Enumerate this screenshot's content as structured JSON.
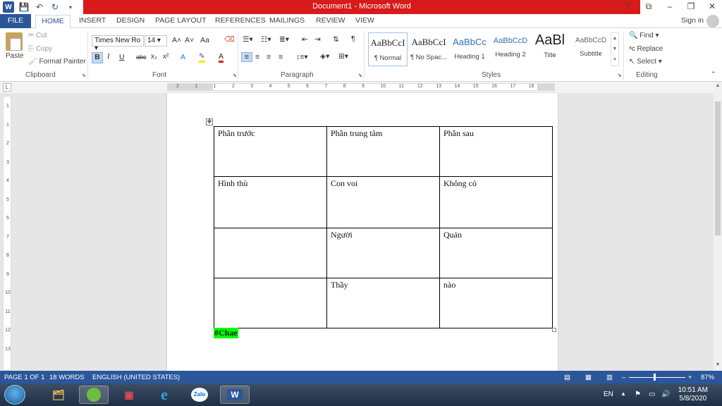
{
  "window": {
    "title": "Document1 - Microsoft Word",
    "controls": [
      "?",
      "⧉",
      "–",
      "❐",
      "✕"
    ]
  },
  "qat": {
    "word_icon": "W",
    "save_icon": "save-icon",
    "undo_icon": "undo-icon",
    "redo_icon": "redo-icon"
  },
  "tabs": [
    "FILE",
    "HOME",
    "INSERT",
    "DESIGN",
    "PAGE LAYOUT",
    "REFERENCES",
    "MAILINGS",
    "REVIEW",
    "VIEW"
  ],
  "signin": "Sign in",
  "clipboard": {
    "paste": "Paste",
    "cut": "Cut",
    "copy": "Copy",
    "format_painter": "Format Painter",
    "label": "Clipboard"
  },
  "font": {
    "name": "Times New Ro",
    "size": "14",
    "grow": "A˄",
    "shrink": "A˅",
    "case": "Aa",
    "bold": "B",
    "italic": "I",
    "underline": "U",
    "strike": "abc",
    "subscript": "x₂",
    "superscript": "x²",
    "label": "Font"
  },
  "paragraph": {
    "label": "Paragraph"
  },
  "styles": {
    "items": [
      {
        "sample": "AaBbCcI",
        "name": "¶ Normal"
      },
      {
        "sample": "AaBbCcI",
        "name": "¶ No Spac..."
      },
      {
        "sample": "AaBbCc",
        "name": "Heading 1"
      },
      {
        "sample": "AaBbCcD",
        "name": "Heading 2"
      },
      {
        "sample": "AaBl",
        "name": "Title"
      },
      {
        "sample": "AaBbCcD",
        "name": "Subtitle"
      }
    ],
    "label": "Styles"
  },
  "editing": {
    "find": "Find",
    "replace": "Replace",
    "select": "Select",
    "label": "Editing"
  },
  "ruler": {
    "h_ticks": [
      "2",
      "1",
      "1",
      "2",
      "3",
      "4",
      "5",
      "6",
      "7",
      "8",
      "9",
      "10",
      "11",
      "12",
      "13",
      "14",
      "15",
      "16",
      "17",
      "18"
    ],
    "v_ticks": [
      "1",
      "1",
      "2",
      "3",
      "4",
      "5",
      "6",
      "7",
      "8",
      "9",
      "10",
      "11",
      "12",
      "13"
    ]
  },
  "table": {
    "rows": [
      [
        "Phần trước",
        "Phần trung tâm",
        "Phần sau"
      ],
      [
        "Hình thù",
        "Con voi",
        "Không có"
      ],
      [
        "",
        "Người",
        "Quản"
      ],
      [
        "",
        "Thầy",
        "nào"
      ]
    ]
  },
  "hashtag": "#Chae",
  "status": {
    "page": "PAGE 1 OF 1",
    "words": "18 WORDS",
    "language": "ENGLISH (UNITED STATES)",
    "zoom": "87%",
    "zoom_level": 0.87
  },
  "taskbar": {
    "apps": [
      "file-explorer-icon",
      "browser-icon",
      "app-icon",
      "internet-explorer-icon",
      "zalo-icon",
      "word-icon"
    ],
    "zalo_label": "Zalo",
    "lang": "EN",
    "time": "10:51 AM",
    "date": "5/8/2020"
  }
}
